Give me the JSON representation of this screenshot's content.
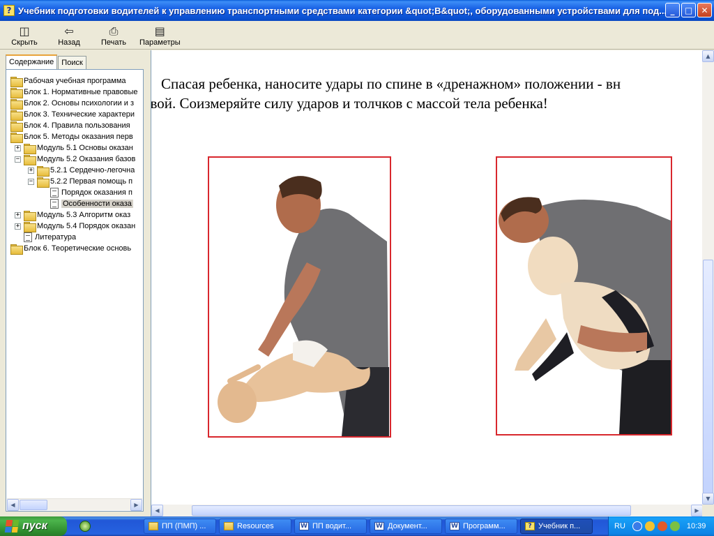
{
  "window": {
    "title": "Учебник подготовки водителей к управлению транспортными средствами категории &quot;B&quot;, оборудованными устройствами для под..."
  },
  "toolbar": {
    "buttons": [
      {
        "label": "Скрыть",
        "icon": "hide-icon"
      },
      {
        "label": "Назад",
        "icon": "back-arrow-icon"
      },
      {
        "label": "Печать",
        "icon": "printer-icon"
      },
      {
        "label": "Параметры",
        "icon": "options-icon"
      }
    ]
  },
  "nav": {
    "tabs": [
      "Содержание",
      "Поиск"
    ],
    "tree": [
      {
        "label": "Рабочая учебная программа",
        "type": "folder",
        "level": 0
      },
      {
        "label": "Блок 1. Нормативные правовые",
        "type": "folder",
        "level": 0
      },
      {
        "label": "Блок 2. Основы психологии и з",
        "type": "folder",
        "level": 0
      },
      {
        "label": "Блок 3. Технические характери",
        "type": "folder",
        "level": 0
      },
      {
        "label": "Блок 4. Правила пользования",
        "type": "folder",
        "level": 0
      },
      {
        "label": "Блок 5. Методы оказания перв",
        "type": "folder",
        "level": 0
      },
      {
        "label": "Модуль 5.1 Основы оказан",
        "type": "folder",
        "level": 1,
        "expander": "+"
      },
      {
        "label": "Модуль 5.2 Оказания базов",
        "type": "folder",
        "level": 1,
        "expander": "−"
      },
      {
        "label": "5.2.1 Сердечно-легочна",
        "type": "folder",
        "level": 2,
        "expander": "+"
      },
      {
        "label": "5.2.2 Первая помощь п",
        "type": "folder",
        "level": 2,
        "expander": "−"
      },
      {
        "label": "Порядок оказания п",
        "type": "doc",
        "level": 3
      },
      {
        "label": "Особенности оказа",
        "type": "doc",
        "level": 3,
        "selected": true
      },
      {
        "label": "Модуль 5.3 Алгоритм оказ",
        "type": "folder",
        "level": 1,
        "expander": "+"
      },
      {
        "label": "Модуль 5.4 Порядок оказан",
        "type": "folder",
        "level": 1,
        "expander": "+"
      },
      {
        "label": "Литература",
        "type": "doc",
        "level": 1
      },
      {
        "label": "Блок 6. Теоретические основь",
        "type": "folder",
        "level": 0
      }
    ]
  },
  "content": {
    "line1": "Спасая ребенка, наносите удары по спине в «дренажном» положении  - вн",
    "line2": "овой. Соизмеряйте силу ударов и толчков с массой тела ребенка!"
  },
  "taskbar": {
    "start_label": "пуск",
    "tasks": [
      {
        "label": "ПП (ПМП) ...",
        "icon": "folder-icon"
      },
      {
        "label": "Resources",
        "icon": "folder-icon"
      },
      {
        "label": "ПП водит...",
        "icon": "word-icon"
      },
      {
        "label": "Документ...",
        "icon": "word-icon"
      },
      {
        "label": "Программ...",
        "icon": "word-icon"
      },
      {
        "label": "Учебник п...",
        "icon": "help-icon",
        "active": true
      }
    ],
    "tray": {
      "lang": "RU",
      "time": "10:39"
    }
  }
}
